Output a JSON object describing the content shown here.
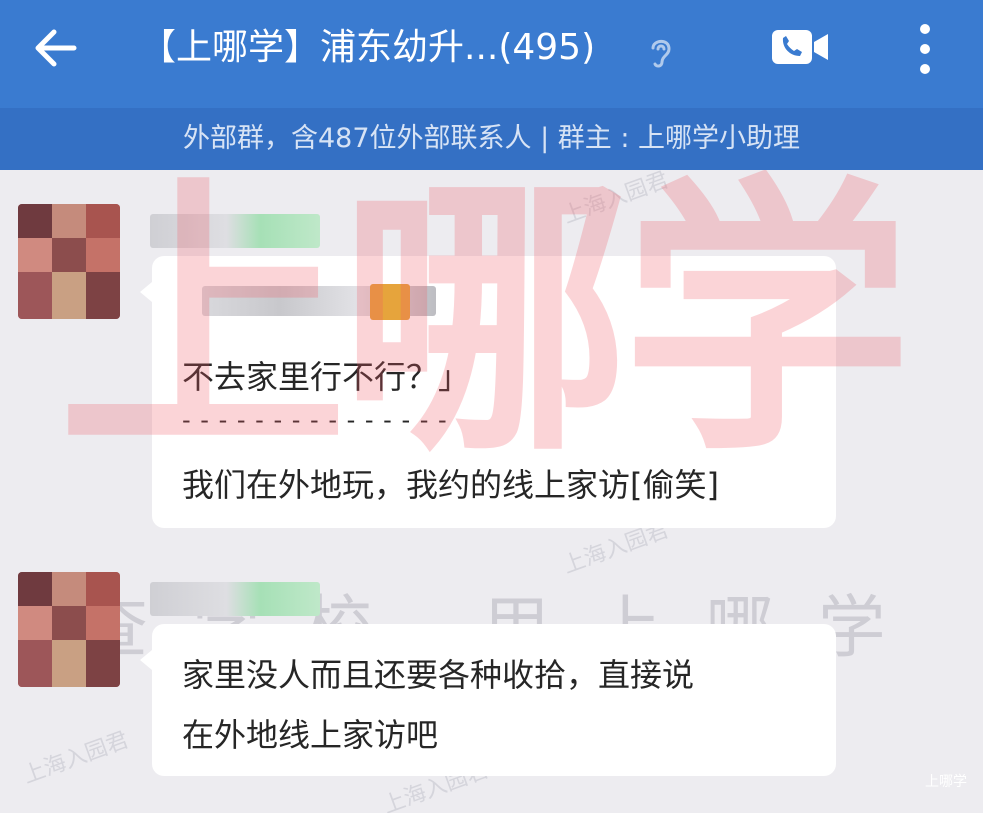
{
  "header": {
    "title": "【上哪学】浦东幼升...(495)",
    "back_icon": "arrow-left-icon",
    "ear_icon": "ear-icon",
    "video_icon": "video-call-icon",
    "more_icon": "more-vertical-icon",
    "bg_color": "#3a7bd0"
  },
  "group_info": {
    "text": "外部群，含487位外部联系人 | 群主 : 上哪学小助理"
  },
  "messages": [
    {
      "lines": [
        "不去家里行不行？」",
        "- - - - - - - - - - - - - - -",
        "我们在外地玩，我约的线上家访[偷笑]"
      ]
    },
    {
      "lines": [
        "家里没人而且还要各种收拾，直接说",
        "在外地线上家访吧"
      ]
    }
  ],
  "watermark": {
    "big": "上哪学",
    "row": "查学校 用上哪学",
    "small": "上海入园君",
    "corner": "上哪学"
  }
}
